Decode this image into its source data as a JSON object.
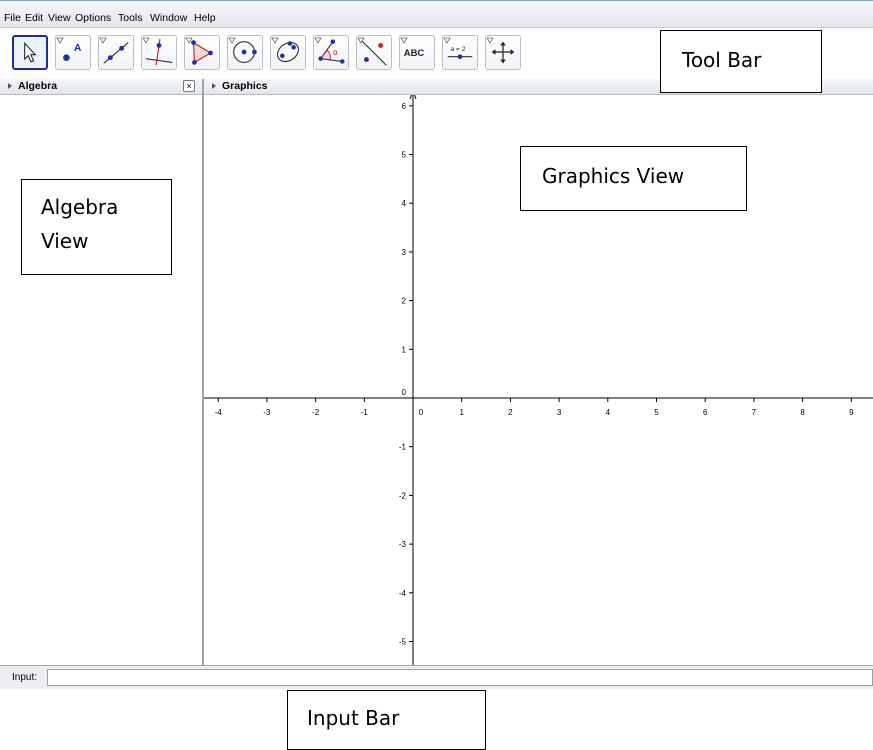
{
  "menu": {
    "file": "File",
    "edit": "Edit",
    "view": "View",
    "options": "Options",
    "tools": "Tools",
    "window": "Window",
    "help": "Help"
  },
  "toolbar": {
    "tools": [
      {
        "name": "move-tool",
        "icon": "arrow-pointer-icon",
        "selected": true
      },
      {
        "name": "new-point-tool",
        "icon": "point-icon",
        "label": "A"
      },
      {
        "name": "line-tool",
        "icon": "line-through-two-points-icon"
      },
      {
        "name": "perpendicular-line-tool",
        "icon": "perpendicular-line-icon"
      },
      {
        "name": "polygon-tool",
        "icon": "polygon-icon"
      },
      {
        "name": "circle-tool",
        "icon": "circle-center-point-icon"
      },
      {
        "name": "conic-tool",
        "icon": "ellipse-icon"
      },
      {
        "name": "angle-tool",
        "icon": "angle-icon",
        "label": "α"
      },
      {
        "name": "reflect-tool",
        "icon": "reflect-about-line-icon"
      },
      {
        "name": "text-tool",
        "icon": "text-icon",
        "label": "ABC"
      },
      {
        "name": "slider-tool",
        "icon": "slider-icon",
        "label": "a = 2"
      },
      {
        "name": "move-graphics-view-tool",
        "icon": "move-cross-arrows-icon"
      }
    ],
    "accent_color": "#1a2f8f",
    "point_color": "#1f2fa8",
    "red_color": "#c0212a"
  },
  "algebra": {
    "title": "Algebra",
    "close_symbol": "×"
  },
  "graphics": {
    "title": "Graphics",
    "x_ticks": [
      "-4",
      "-3",
      "-2",
      "-1",
      "0",
      "1",
      "2",
      "3",
      "4",
      "5",
      "6",
      "7",
      "8",
      "9"
    ],
    "y_ticks": [
      "6",
      "5",
      "4",
      "3",
      "2",
      "1",
      "-1",
      "-2",
      "-3",
      "-4",
      "-5"
    ],
    "origin_label": "0"
  },
  "input": {
    "label": "Input:",
    "value": "",
    "placeholder": ""
  },
  "callouts": {
    "tool_bar": "Tool Bar",
    "graphics_view": "Graphics View",
    "algebra_line1": "Algebra",
    "algebra_line2": "View",
    "input_bar": "Input Bar"
  }
}
